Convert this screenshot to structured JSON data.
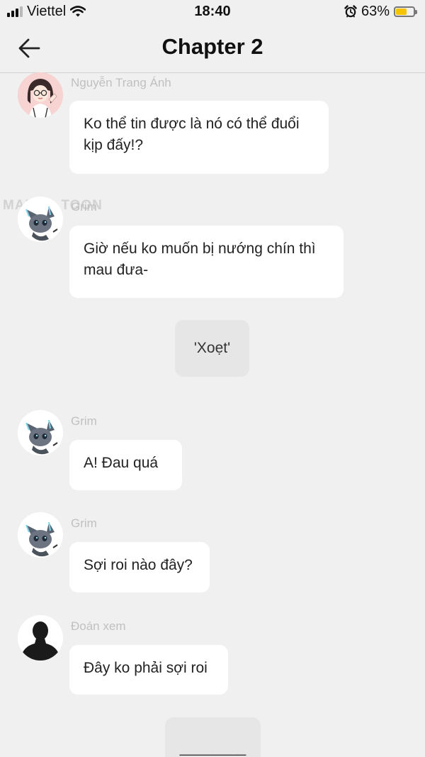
{
  "status_bar": {
    "carrier": "Viettel",
    "time": "18:40",
    "battery_percent": "63%",
    "battery_level": 0.63,
    "icons": [
      "signal-icon",
      "wifi-icon",
      "alarm-icon",
      "battery-icon"
    ]
  },
  "header": {
    "title": "Chapter 2",
    "back_icon": "arrow-left-icon"
  },
  "watermark": "MANGA TOON",
  "messages": [
    {
      "sender": "Nguyễn Trang Ánh",
      "text": "Ko thể tin được là nó có thể đuổi kịp đấy!?",
      "avatar": "girl-avatar"
    },
    {
      "sender": "Grim",
      "text": "Giờ nếu ko muốn bị nướng chín thì mau đưa-",
      "avatar": "cat-avatar"
    },
    {
      "narration": "'Xoẹt'"
    },
    {
      "sender": "Grim",
      "text": "A! Đau quá",
      "avatar": "cat-avatar"
    },
    {
      "sender": "Grim",
      "text": "Sợi roi nào đây?",
      "avatar": "cat-avatar"
    },
    {
      "sender": "Đoán xem",
      "text": "Đây ko phải sợi roi",
      "avatar": "silhouette-avatar"
    },
    {
      "narration": "________"
    }
  ],
  "colors": {
    "background": "#f0f0f0",
    "bubble": "#ffffff",
    "narration_bubble": "#e6e6e6",
    "sender_name": "#c0c0c0",
    "battery_fill": "#f5c400"
  }
}
